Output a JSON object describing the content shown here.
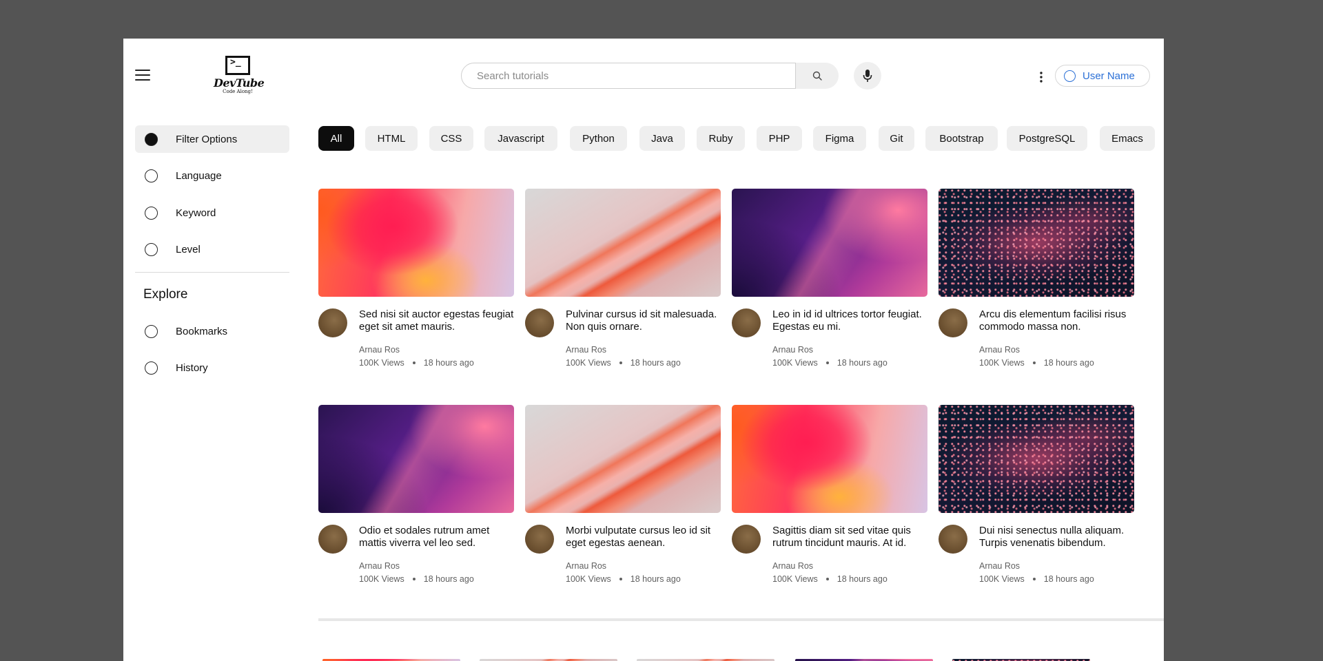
{
  "header": {
    "logo": {
      "glyph": ">_",
      "name": "DevTube",
      "tagline": "Code Along!"
    },
    "search": {
      "placeholder": "Search tutorials",
      "value": ""
    },
    "user": {
      "label": "User Name"
    }
  },
  "sidebar": {
    "filters": [
      {
        "label": "Filter Options",
        "active": true
      },
      {
        "label": "Language",
        "active": false
      },
      {
        "label": "Keyword",
        "active": false
      },
      {
        "label": "Level",
        "active": false
      }
    ],
    "explore_heading": "Explore",
    "explore": [
      {
        "label": "Bookmarks"
      },
      {
        "label": "History"
      }
    ]
  },
  "chips": [
    "All",
    "HTML",
    "CSS",
    "Javascript",
    "Python",
    "Java",
    "Ruby",
    "PHP",
    "Figma",
    "Git",
    "Bootstrap",
    "PostgreSQL",
    "Emacs"
  ],
  "active_chip": "All",
  "videos": [
    {
      "title": "Sed nisi sit auctor egestas feugiat eget sit amet mauris.",
      "channel": "Arnau Ros",
      "views": "100K Views",
      "time": "18 hours ago",
      "thumb": "warm"
    },
    {
      "title": "Pulvinar cursus id sit malesuada. Non quis ornare.",
      "channel": "Arnau Ros",
      "views": "100K Views",
      "time": "18 hours ago",
      "thumb": "marble"
    },
    {
      "title": "Leo in id id ultrices tortor feugiat. Egestas eu mi.",
      "channel": "Arnau Ros",
      "views": "100K Views",
      "time": "18 hours ago",
      "thumb": "purple"
    },
    {
      "title": "Arcu dis elementum facilisi risus commodo massa non.",
      "channel": "Arnau Ros",
      "views": "100K Views",
      "time": "18 hours ago",
      "thumb": "galaxy"
    },
    {
      "title": "Odio et sodales rutrum amet mattis viverra vel leo sed.",
      "channel": "Arnau Ros",
      "views": "100K Views",
      "time": "18 hours ago",
      "thumb": "purple"
    },
    {
      "title": "Morbi vulputate cursus leo id sit eget egestas aenean.",
      "channel": "Arnau Ros",
      "views": "100K Views",
      "time": "18 hours ago",
      "thumb": "marble"
    },
    {
      "title": "Sagittis diam sit sed vitae quis rutrum tincidunt mauris. At id.",
      "channel": "Arnau Ros",
      "views": "100K Views",
      "time": "18 hours ago",
      "thumb": "warm"
    },
    {
      "title": "Dui nisi senectus nulla aliquam. Turpis venenatis bibendum.",
      "channel": "Arnau Ros",
      "views": "100K Views",
      "time": "18 hours ago",
      "thumb": "galaxy"
    }
  ],
  "colors": {
    "accent": "#2a6fd6",
    "page_bg": "#545454",
    "chip_bg": "#efefef",
    "chip_active_bg": "#0d0d0d"
  }
}
